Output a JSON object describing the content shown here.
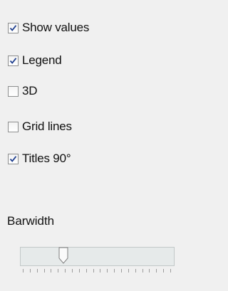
{
  "options": [
    {
      "label": "Show values",
      "checked": true
    },
    {
      "label": "Legend",
      "checked": true
    },
    {
      "label": "3D",
      "checked": false
    },
    {
      "label": "Grid lines",
      "checked": false
    },
    {
      "label": "Titles 90°",
      "checked": true
    }
  ],
  "barwidth": {
    "label": "Barwidth",
    "value_fraction": 0.26,
    "tick_count": 22
  },
  "colors": {
    "panel_bg": "#f0f0f0",
    "check_mark": "#1f3f8f"
  }
}
